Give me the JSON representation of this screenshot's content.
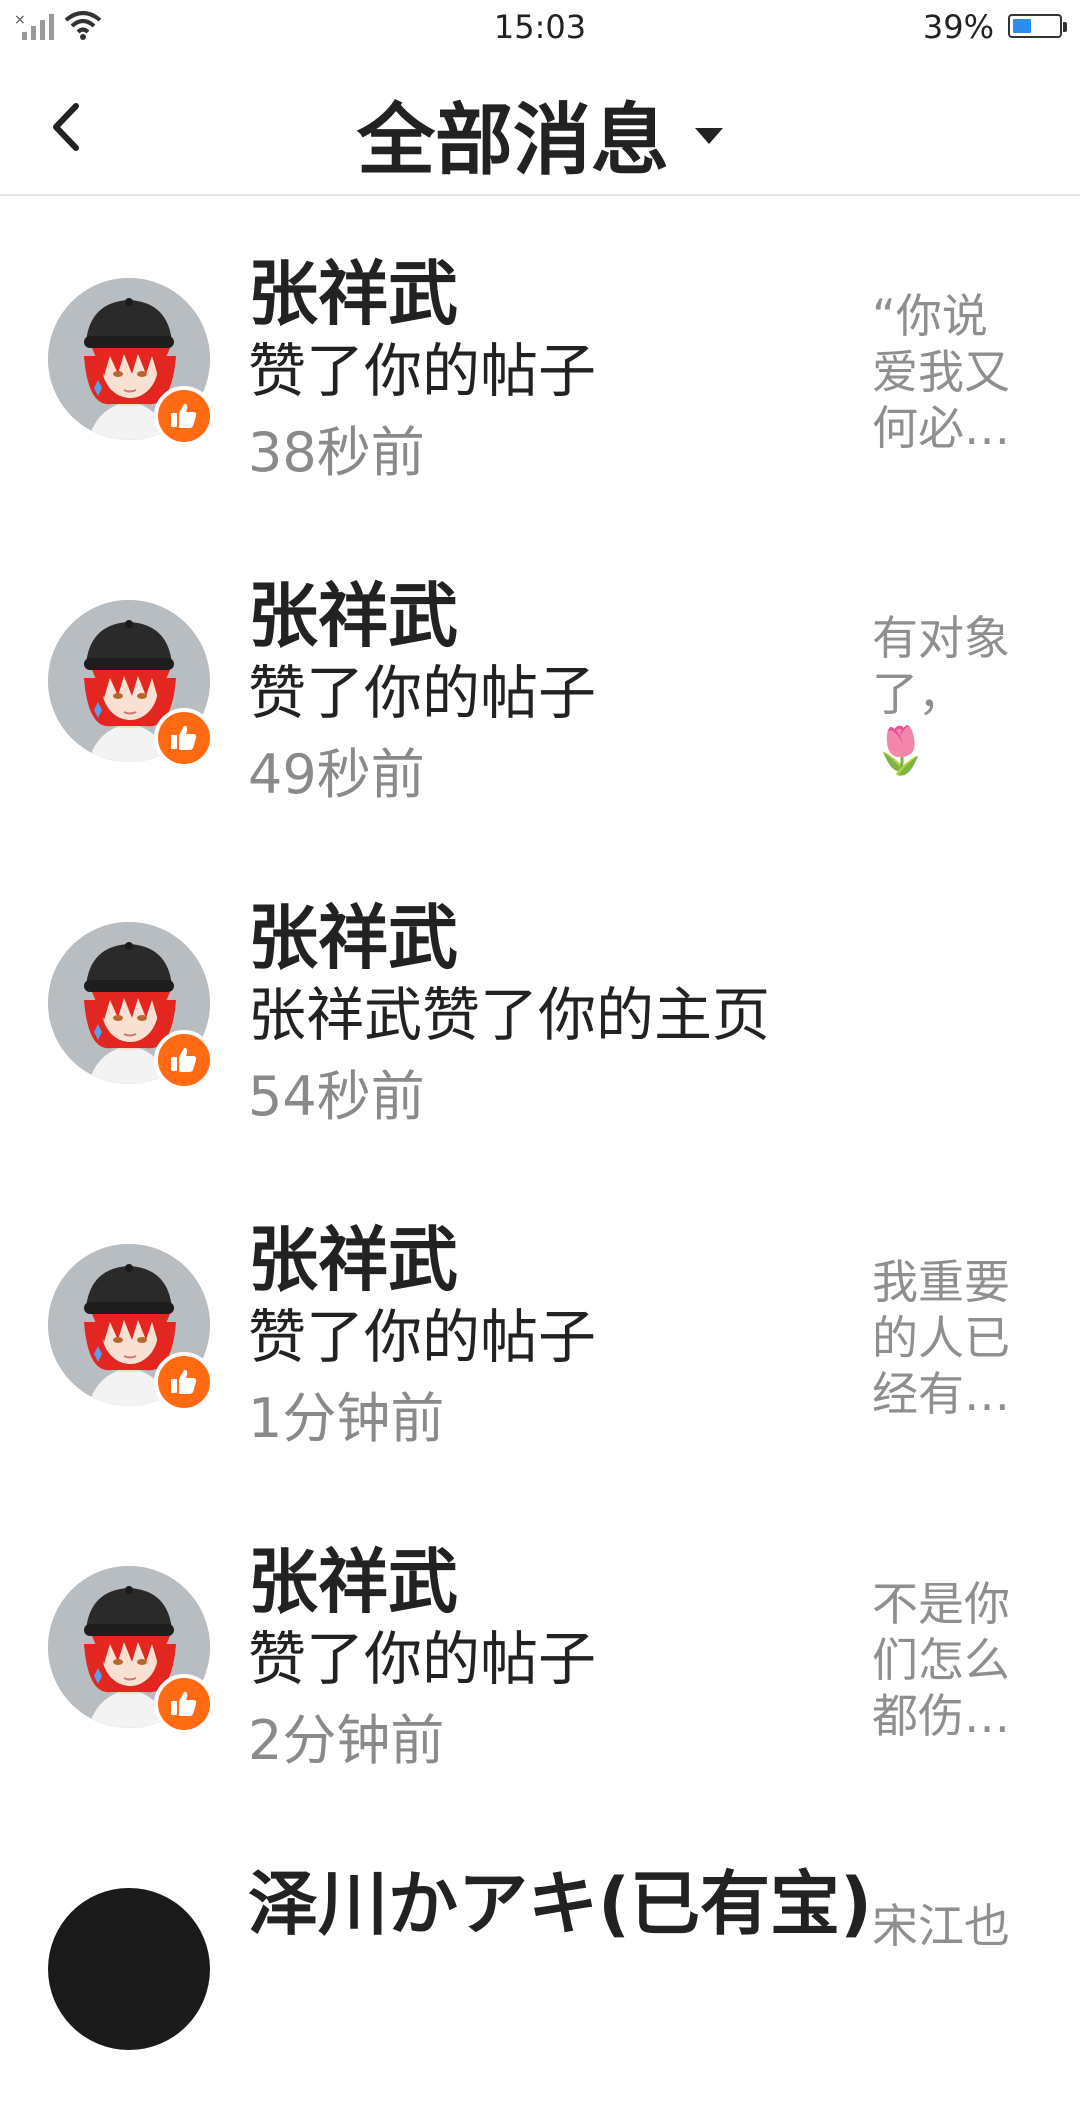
{
  "status_bar": {
    "time": "15:03",
    "battery": "39%"
  },
  "header": {
    "title": "全部消息"
  },
  "messages": [
    {
      "name": "张祥武",
      "action": "赞了你的帖子",
      "time": "38秒前",
      "preview": "“你说爱我又何必…"
    },
    {
      "name": "张祥武",
      "action": "赞了你的帖子",
      "time": "49秒前",
      "preview": "有对象了，🌷😊…"
    },
    {
      "name": "张祥武",
      "action": "张祥武赞了你的主页",
      "time": "54秒前",
      "preview": ""
    },
    {
      "name": "张祥武",
      "action": "赞了你的帖子",
      "time": "1分钟前",
      "preview": "我重要的人已经有…"
    },
    {
      "name": "张祥武",
      "action": "赞了你的帖子",
      "time": "2分钟前",
      "preview": "不是你们怎么都伤…"
    },
    {
      "name": "泽川かアキ(已有宝)",
      "action": "",
      "time": "",
      "preview": "宋江也"
    }
  ]
}
